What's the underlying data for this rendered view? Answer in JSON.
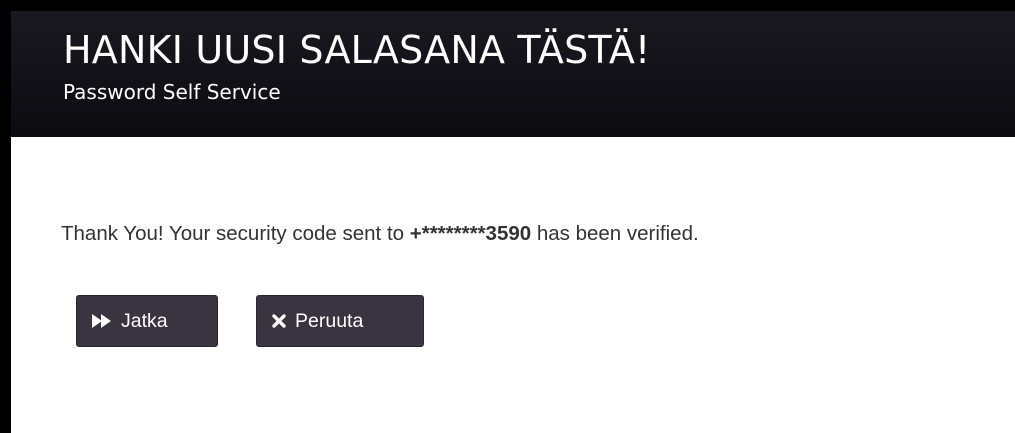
{
  "header": {
    "title": "HANKI UUSI SALASANA TÄSTÄ!",
    "subtitle": "Password Self Service",
    "background_color": "#0f0e13"
  },
  "message": {
    "prefix": "Thank You! Your security code sent to ",
    "phone": "+********3590",
    "suffix": " has been verified."
  },
  "buttons": {
    "continue": {
      "label": "Jatka",
      "icon": "fast-forward-icon"
    },
    "cancel": {
      "label": "Peruuta",
      "icon": "close-icon"
    },
    "background_color": "#3a3340"
  }
}
